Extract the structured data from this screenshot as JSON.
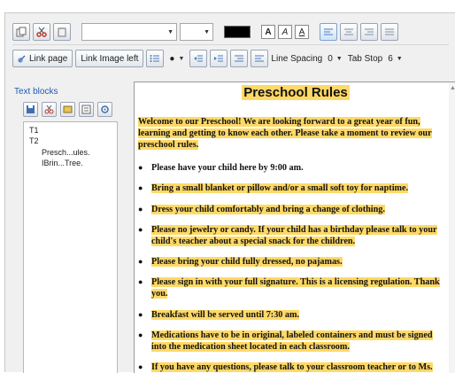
{
  "toolbar": {
    "font_combo": "",
    "size_combo": "",
    "link_page_label": "Link page",
    "link_image_left_label": "Link Image left",
    "line_spacing_label": "Line Spacing",
    "line_spacing_value": "0",
    "tab_stop_label": "Tab Stop",
    "tab_stop_value": "6",
    "format_buttons": [
      "A",
      "A",
      "A"
    ]
  },
  "sidebar": {
    "title": "Text blocks",
    "tree": [
      "T1",
      "T2",
      "Presch...ules.",
      "IBrin...Tree."
    ]
  },
  "document": {
    "title": "Preschool Rules",
    "intro": "Welcome to our Preschool! We are looking forward to a great year of fun, learning and getting to know each other. Please take a moment to review our preschool rules.",
    "rules": [
      "Please have your child here by 9:00 am.",
      "Bring a small blanket or pillow and/or a small soft toy for naptime.",
      "Dress your child comfortably and bring a change of clothing.",
      "Please no jewelry or candy. If your child has a birthday please talk to your child's teacher about a special snack for the children.",
      "Please bring your child fully dressed, no pajamas.",
      "Please sign in with your full signature. This is a licensing regulation. Thank you.",
      "Breakfast will be served until 7:30 am.",
      "Medications have to be in original, labeled containers and must be signed into the medication sheet located in each classroom.",
      "If you have any questions, please talk to your classroom teacher or to Ms. Marlene or Ms. Tree."
    ]
  },
  "colors": {
    "highlight": "#ffd966",
    "panel_title": "#1e5cb3"
  }
}
